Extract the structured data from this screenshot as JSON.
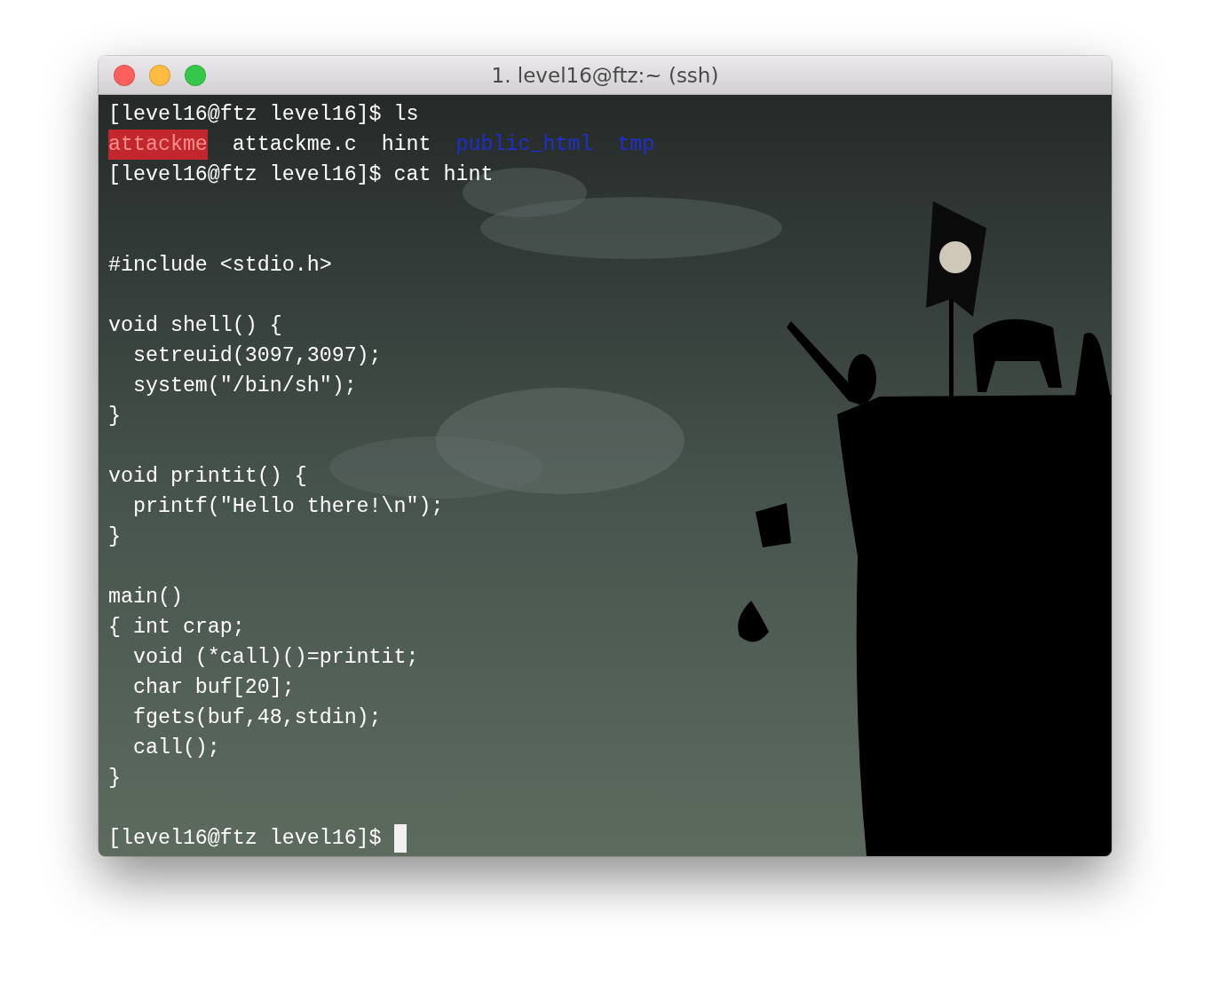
{
  "window": {
    "title": "1. level16@ftz:~ (ssh)",
    "buttons": [
      {
        "color": "#fc605c"
      },
      {
        "color": "#fdbc40"
      },
      {
        "color": "#34c84a"
      }
    ]
  },
  "terminal": {
    "lines": [
      {
        "kind": "text",
        "text": "[level16@ftz level16]$ ls"
      },
      {
        "kind": "listing",
        "entries": [
          {
            "name": "attackme",
            "kind": "executable"
          },
          {
            "name": "attackme.c",
            "kind": "file"
          },
          {
            "name": "hint",
            "kind": "file"
          },
          {
            "name": "public_html",
            "kind": "directory"
          },
          {
            "name": "tmp",
            "kind": "directory"
          }
        ]
      },
      {
        "kind": "text",
        "text": "[level16@ftz level16]$ cat hint"
      },
      {
        "kind": "blank"
      },
      {
        "kind": "blank"
      },
      {
        "kind": "text",
        "text": "#include <stdio.h>"
      },
      {
        "kind": "blank"
      },
      {
        "kind": "text",
        "text": "void shell() {"
      },
      {
        "kind": "text",
        "text": "  setreuid(3097,3097);"
      },
      {
        "kind": "text",
        "text": "  system(\"/bin/sh\");"
      },
      {
        "kind": "text",
        "text": "}"
      },
      {
        "kind": "blank"
      },
      {
        "kind": "text",
        "text": "void printit() {"
      },
      {
        "kind": "text",
        "text": "  printf(\"Hello there!\\n\");"
      },
      {
        "kind": "text",
        "text": "}"
      },
      {
        "kind": "blank"
      },
      {
        "kind": "text",
        "text": "main()"
      },
      {
        "kind": "text",
        "text": "{ int crap;"
      },
      {
        "kind": "text",
        "text": "  void (*call)()=printit;"
      },
      {
        "kind": "text",
        "text": "  char buf[20];"
      },
      {
        "kind": "text",
        "text": "  fgets(buf,48,stdin);"
      },
      {
        "kind": "text",
        "text": "  call();"
      },
      {
        "kind": "text",
        "text": "}"
      },
      {
        "kind": "blank"
      },
      {
        "kind": "prompt",
        "text": "[level16@ftz level16]$",
        "cursor": true
      }
    ]
  }
}
